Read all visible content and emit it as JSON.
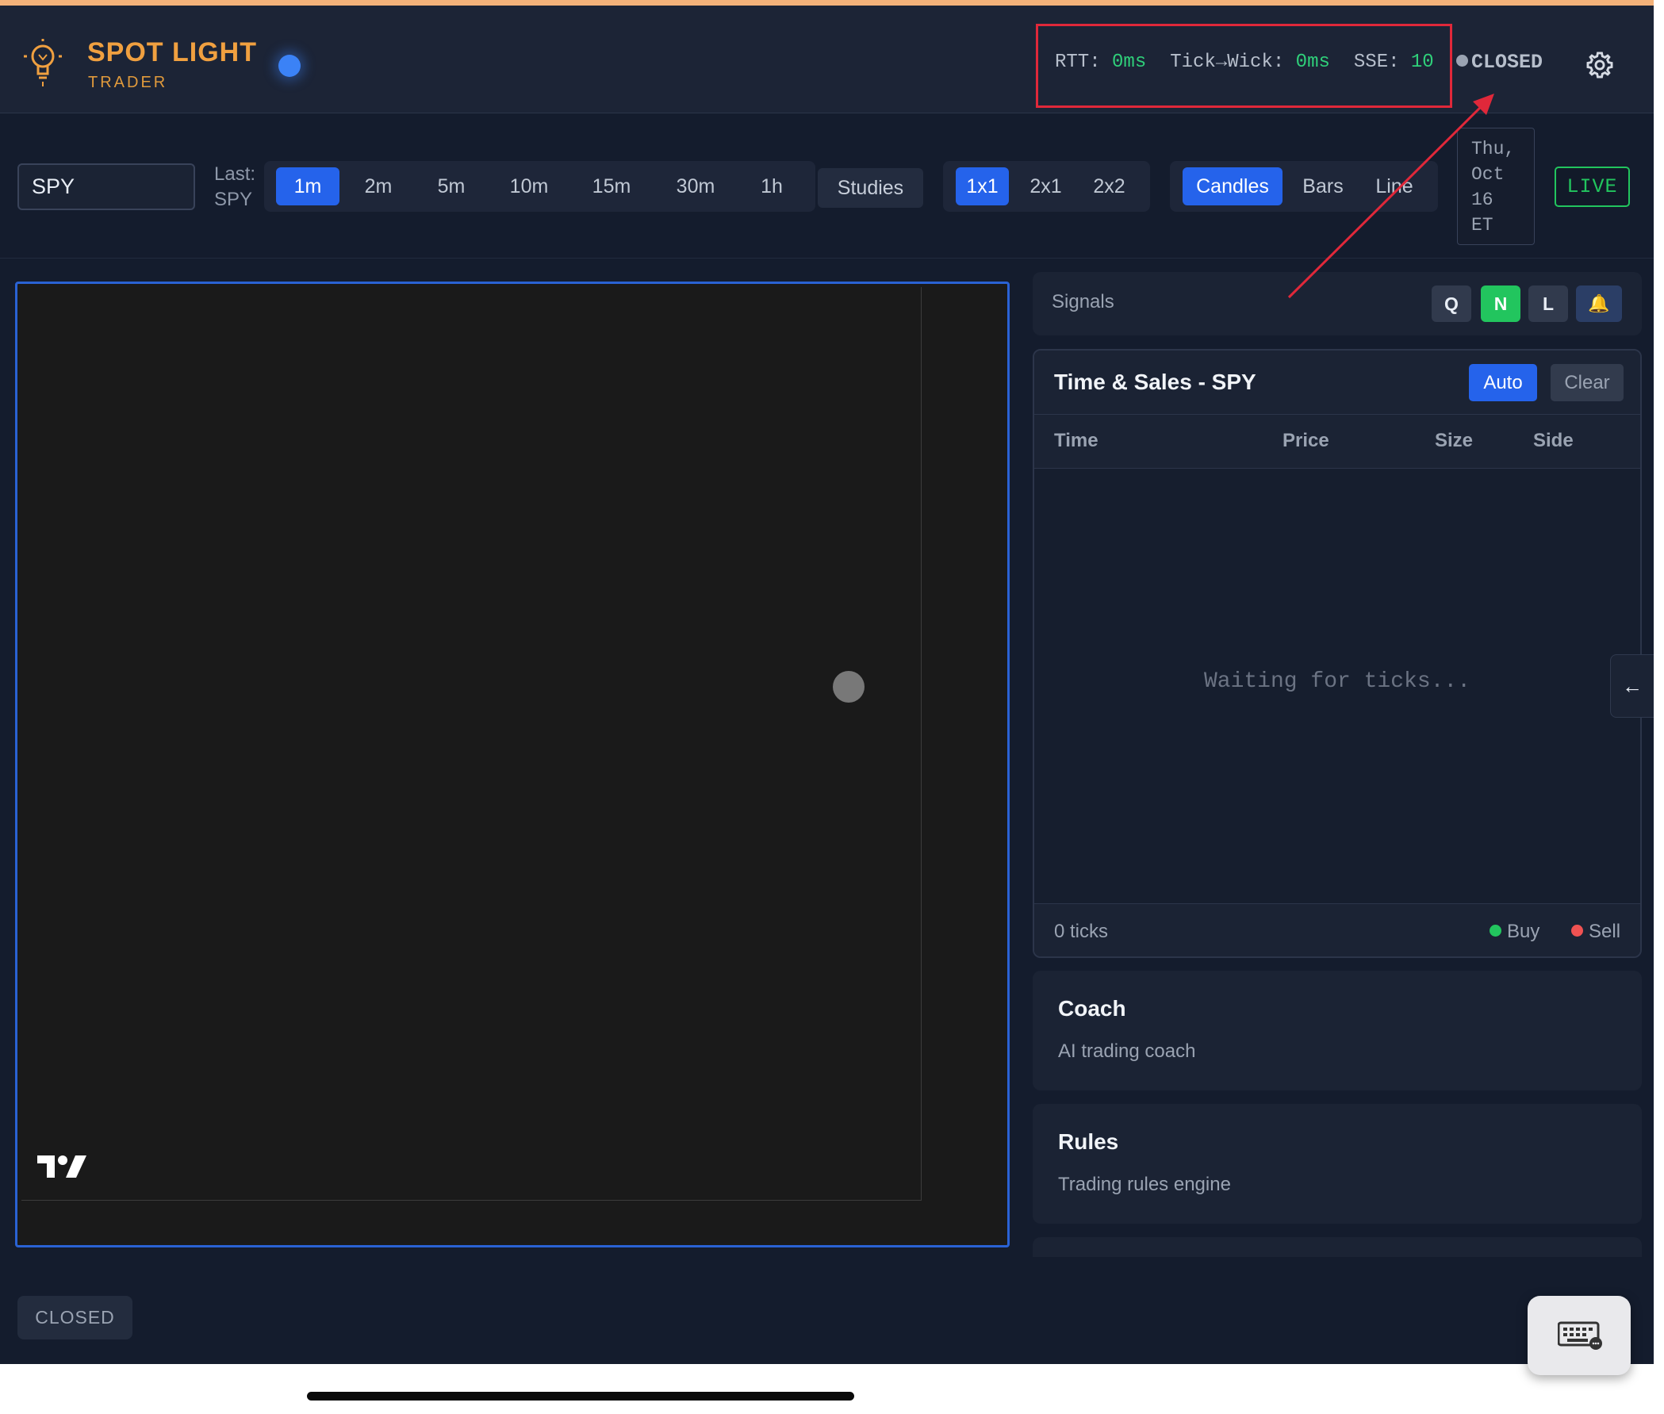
{
  "header": {
    "brand_title": "SPOT LIGHT",
    "brand_subtitle": "TRADER",
    "metrics": {
      "rtt_label": "RTT:",
      "rtt_value": "0ms",
      "tick_label": "Tick→Wick:",
      "tick_value": "0ms",
      "sse_label": "SSE:",
      "sse_value": "10"
    },
    "connection_status": "CLOSED"
  },
  "toolbar": {
    "symbol_value": "SPY",
    "last_label": "Last:",
    "last_symbol": "SPY",
    "timeframes": [
      "1m",
      "2m",
      "5m",
      "10m",
      "15m",
      "30m",
      "1h"
    ],
    "active_timeframe": "1m",
    "studies_label": "Studies",
    "layouts": [
      "1x1",
      "2x1",
      "2x2"
    ],
    "active_layout": "1x1",
    "chart_types": [
      "Candles",
      "Bars",
      "Line"
    ],
    "active_chart_type": "Candles",
    "date_lines": [
      "Thu,",
      "Oct",
      "16",
      "ET"
    ],
    "live_label": "LIVE"
  },
  "signals": {
    "label": "Signals",
    "buttons": [
      "Q",
      "N",
      "L"
    ],
    "bell_icon": "🔔"
  },
  "time_sales": {
    "title": "Time & Sales - SPY",
    "auto_label": "Auto",
    "clear_label": "Clear",
    "columns": [
      "Time",
      "Price",
      "Size",
      "Side"
    ],
    "empty_message": "Waiting for ticks...",
    "tick_count": "0 ticks",
    "legend_buy": "Buy",
    "legend_sell": "Sell"
  },
  "cards": {
    "coach_title": "Coach",
    "coach_desc": "AI trading coach",
    "rules_title": "Rules",
    "rules_desc": "Trading rules engine"
  },
  "collapse_arrow": "←",
  "footer": {
    "status": "CLOSED"
  },
  "colors": {
    "accent": "#2563eb",
    "brand": "#f0a040",
    "live": "#22c55e",
    "metric_value": "#2fd07a",
    "annotation": "#e0283a"
  }
}
